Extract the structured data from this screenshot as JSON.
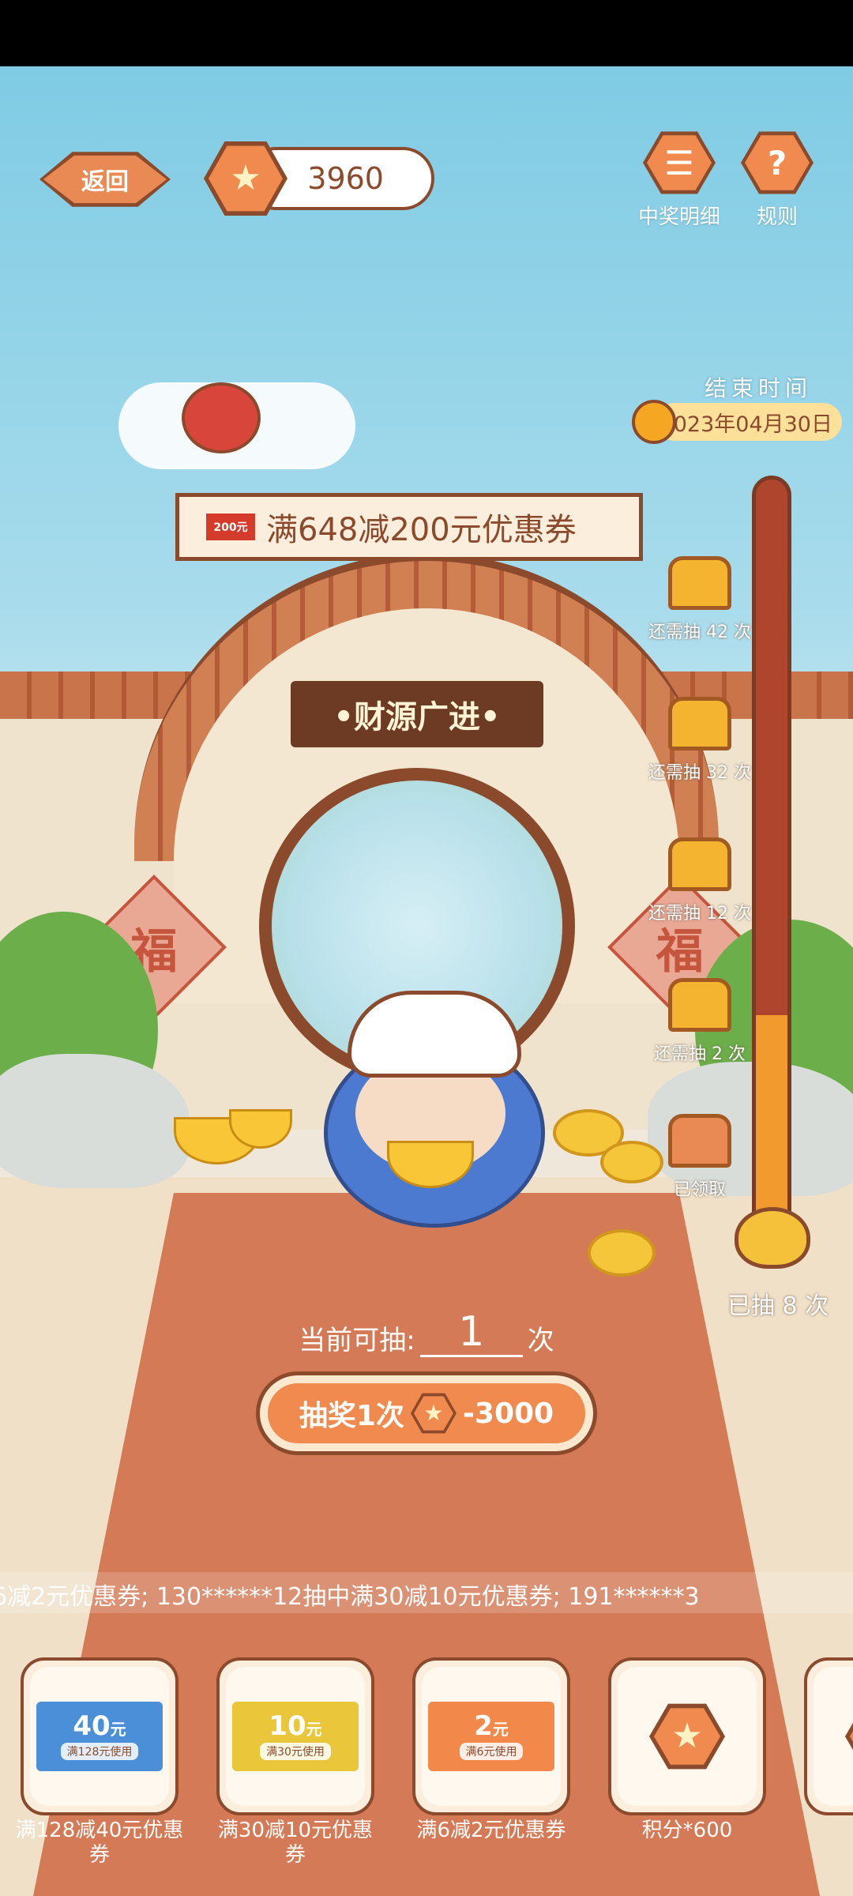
{
  "header": {
    "back_label": "返回",
    "points": "3960",
    "records_label": "中奖明细",
    "rules_label": "规则",
    "records_icon": "menu-icon",
    "rules_icon": "question-icon"
  },
  "campaign": {
    "end_title": "结束时间",
    "end_date": "2023年04月30日",
    "prize_banner_text": "满648减200元优惠券",
    "prize_banner_ticket": "200元",
    "gate_sign": "•财源广进•",
    "fu_char": "福"
  },
  "progress": {
    "milestones": [
      {
        "label": "还需抽 42 次",
        "state": "locked"
      },
      {
        "label": "还需抽 32 次",
        "state": "locked"
      },
      {
        "label": "还需抽 12 次",
        "state": "locked"
      },
      {
        "label": "还需抽 2 次",
        "state": "locked"
      },
      {
        "label": "已领取",
        "state": "claimed"
      }
    ],
    "drawn_label": "已抽 8 次"
  },
  "draw": {
    "available_prefix": "当前可抽:",
    "available_count": "1",
    "available_suffix": "次",
    "button_label": "抽奖1次",
    "button_cost": "-3000"
  },
  "ticker": {
    "text": "6减2元优惠券;    130******12抽中满30减10元优惠券;    191******3"
  },
  "rewards": [
    {
      "amount": "40",
      "unit": "元",
      "condition": "满128元使用",
      "label": "满128减40元优惠券",
      "color": "#4a8fd8"
    },
    {
      "amount": "10",
      "unit": "元",
      "condition": "满30元使用",
      "label": "满30减10元优惠券",
      "color": "#e9c63a"
    },
    {
      "amount": "2",
      "unit": "元",
      "condition": "满6元使用",
      "label": "满6减2元优惠券",
      "color": "#f2894a"
    },
    {
      "amount": "",
      "unit": "",
      "condition": "",
      "label": "积分*600",
      "color": "#f08a4f"
    },
    {
      "amount": "",
      "unit": "",
      "condition": "",
      "label": "积分",
      "color": "#f08a4f"
    }
  ],
  "colors": {
    "brand_orange": "#f08a4f",
    "outline_brown": "#8b4a2b",
    "sky": "#7fcbe4"
  }
}
